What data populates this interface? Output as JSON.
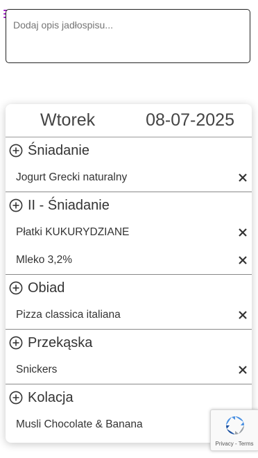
{
  "description": {
    "placeholder": "Dodaj opis jadłospisu..."
  },
  "day": {
    "name": "Wtorek",
    "date": "08-07-2025"
  },
  "meals": [
    {
      "name": "Śniadanie",
      "items": [
        "Jogurt Grecki naturalny"
      ]
    },
    {
      "name": "II - Śniadanie",
      "items": [
        "Płatki KUKURYDZIANE",
        "Mleko 3,2%"
      ]
    },
    {
      "name": "Obiad",
      "items": [
        "Pizza classica italiana"
      ]
    },
    {
      "name": "Przekąska",
      "items": [
        "Snickers"
      ]
    },
    {
      "name": "Kolacja",
      "items": [
        "Musli Chocolate & Banana"
      ]
    }
  ],
  "recaptcha": {
    "links": "Privacy - Terms"
  },
  "colors": {
    "menu_accent": "#a020c8",
    "card_bg": "#ffffff"
  },
  "icons": {
    "menu": "hamburger-menu-icon",
    "add": "plus-circle-icon",
    "remove": "close-icon"
  }
}
